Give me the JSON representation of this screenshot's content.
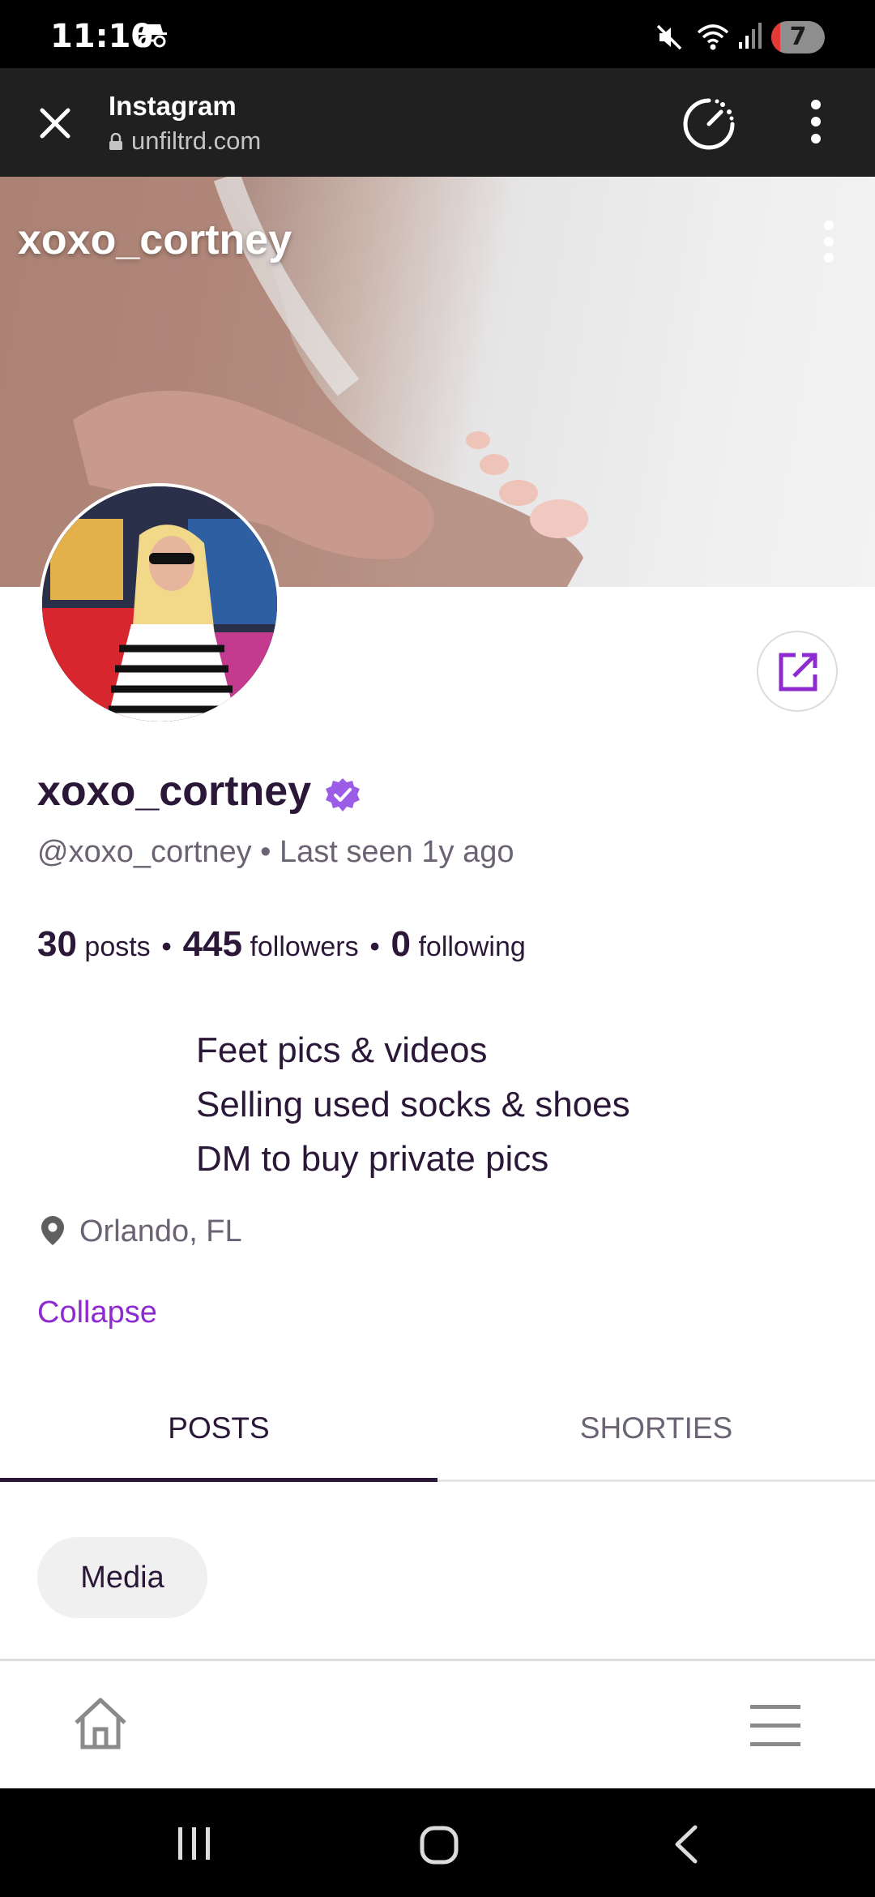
{
  "status_bar": {
    "time": "11:10",
    "battery_level": "7",
    "icons": [
      "incognito-icon",
      "mute-icon",
      "wifi-icon",
      "signal-icon"
    ]
  },
  "browser": {
    "title": "Instagram",
    "url": "unfiltrd.com",
    "icons": [
      "close-icon",
      "lock-icon",
      "speed-icon",
      "menu-icon"
    ]
  },
  "profile": {
    "cover_username": "xoxo_cortney",
    "display_name": "xoxo_cortney",
    "handle": "@xoxo_cortney",
    "separator": "•",
    "last_seen": "Last seen 1y ago",
    "stats": {
      "posts_count": "30",
      "posts_label": "posts",
      "followers_count": "445",
      "followers_label": "followers",
      "following_count": "0",
      "following_label": "following"
    },
    "bio": [
      "Feet pics & videos",
      "Selling used socks & shoes",
      "DM to buy private pics"
    ],
    "location": "Orlando, FL",
    "collapse_label": "Collapse"
  },
  "tabs": [
    {
      "label": "POSTS",
      "active": true
    },
    {
      "label": "SHORTIES",
      "active": false
    }
  ],
  "filter_chip": "Media",
  "colors": {
    "accent": "#8e2bd0",
    "text_primary": "#2b1738",
    "text_secondary": "#6b6373",
    "verified": "#9b5de5"
  }
}
